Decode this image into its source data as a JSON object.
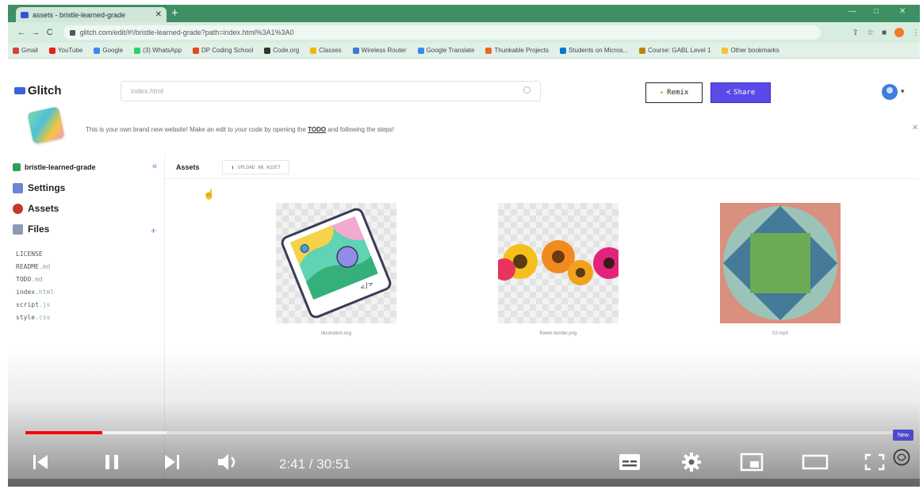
{
  "browser": {
    "tab_title": "assets - bristle-learned-grade",
    "url": "glitch.com/edit/#!/bristle-learned-grade?path=index.html%3A1%3A0",
    "bookmarks": [
      {
        "label": "Gmail",
        "color": "#d44638"
      },
      {
        "label": "YouTube",
        "color": "#e62117"
      },
      {
        "label": "Google",
        "color": "#4285f4"
      },
      {
        "label": "(3) WhatsApp",
        "color": "#25d366"
      },
      {
        "label": "DP Coding School",
        "color": "#e04a1a"
      },
      {
        "label": "Code.org",
        "color": "#333333"
      },
      {
        "label": "Classes",
        "color": "#f4b400"
      },
      {
        "label": "Wireless Router",
        "color": "#3a7bd5"
      },
      {
        "label": "Google Translate",
        "color": "#4285f4"
      },
      {
        "label": "Thunkable Projects",
        "color": "#e9672a"
      },
      {
        "label": "Students on Micros...",
        "color": "#0078d4"
      },
      {
        "label": "Course: GABL Level 1",
        "color": "#b8860b"
      },
      {
        "label": "Other bookmarks",
        "color": "#f4c430"
      }
    ]
  },
  "glitch": {
    "logo": "Glitch",
    "search_value": "index.html",
    "remix_label": "Remix",
    "share_label": "Share",
    "banner_text_before": "This is your own brand new website! Make an edit to your code by opening the ",
    "banner_link": "TODO",
    "banner_text_after": " and following the steps!",
    "project_name": "bristle-learned-grade",
    "collapse_icon": "«",
    "nav": [
      {
        "label": "Settings",
        "color": "#6b86d6"
      },
      {
        "label": "Assets",
        "color": "#c0392b"
      },
      {
        "label": "Files",
        "color": "#8a9bb5"
      }
    ],
    "files": [
      {
        "name": "LICENSE",
        "ext": ""
      },
      {
        "name": "README",
        "ext": ".md"
      },
      {
        "name": "TODO",
        "ext": ".md"
      },
      {
        "name": "index",
        "ext": ".html"
      },
      {
        "name": "script",
        "ext": ".js"
      },
      {
        "name": "style",
        "ext": ".css"
      }
    ],
    "main_tab": "Assets",
    "upload_label": "UPLOAD AN ASSET",
    "assets": [
      {
        "caption": "illustration.svg",
        "code_tag": "</>"
      },
      {
        "caption": "flower-border.png"
      },
      {
        "caption": "02.mp3"
      }
    ]
  },
  "player": {
    "current_time": "2:41",
    "duration": "30:51",
    "time_text": "2:41 / 30:51",
    "new_badge": "New",
    "progress_played": 0.087,
    "progress_buffered": 0.16
  }
}
